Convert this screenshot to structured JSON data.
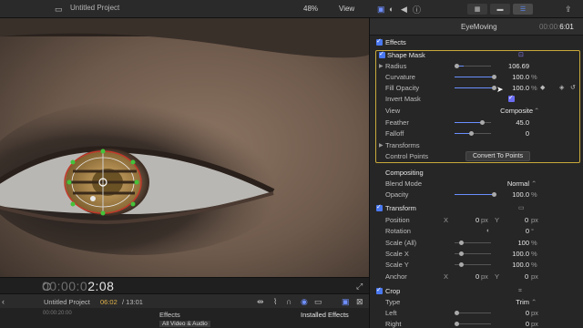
{
  "topbar": {
    "viewer_title": "Untitled Project",
    "zoom": "48%",
    "view_menu": "View"
  },
  "viewer": {
    "timecode_dim": "00:00:0",
    "timecode_bright": "2:08"
  },
  "timeline": {
    "project_name": "Untitled Project",
    "current_time": "06:02",
    "total_time": "/ 13:01",
    "ruler_label": "00:00:20:00",
    "effects_tab": "Effects",
    "effects_sub": "All Video & Audio",
    "installed_effects": "Installed Effects"
  },
  "inspector": {
    "clip_name": "EyeMoving",
    "clip_tc_dim": "00:00:",
    "clip_tc_bright": "6:01",
    "effects_header": "Effects",
    "shape_mask": {
      "title": "Shape Mask",
      "radius": {
        "label": "Radius",
        "value": "106.69"
      },
      "curvature": {
        "label": "Curvature",
        "value": "100.0",
        "unit": "%"
      },
      "fill_opacity": {
        "label": "Fill Opacity",
        "value": "100.0",
        "unit": "%"
      },
      "invert_mask": {
        "label": "Invert Mask"
      },
      "view": {
        "label": "View",
        "value": "Composite"
      },
      "feather": {
        "label": "Feather",
        "value": "45.0"
      },
      "falloff": {
        "label": "Falloff",
        "value": "0"
      },
      "transforms": {
        "label": "Transforms"
      },
      "control_points": {
        "label": "Control Points",
        "button": "Convert To Points"
      }
    },
    "compositing": {
      "header": "Compositing",
      "blend_mode": {
        "label": "Blend Mode",
        "value": "Normal"
      },
      "opacity": {
        "label": "Opacity",
        "value": "100.0",
        "unit": "%"
      }
    },
    "transform": {
      "header": "Transform",
      "position": {
        "label": "Position",
        "x_label": "X",
        "x": "0",
        "y_label": "Y",
        "y": "0",
        "unit": "px"
      },
      "rotation": {
        "label": "Rotation",
        "value": "0",
        "unit": "°"
      },
      "scale_all": {
        "label": "Scale (All)",
        "value": "100",
        "unit": "%"
      },
      "scale_x": {
        "label": "Scale X",
        "value": "100.0",
        "unit": "%"
      },
      "scale_y": {
        "label": "Scale Y",
        "value": "100.0",
        "unit": "%"
      },
      "anchor": {
        "label": "Anchor",
        "x_label": "X",
        "x": "0",
        "y_label": "Y",
        "y": "0",
        "unit": "px"
      }
    },
    "crop": {
      "header": "Crop",
      "type": {
        "label": "Type",
        "value": "Trim"
      },
      "left": {
        "label": "Left",
        "value": "0",
        "unit": "px"
      },
      "right": {
        "label": "Right",
        "value": "0",
        "unit": "px"
      }
    }
  },
  "colors": {
    "accent": "#4a78f0",
    "mask_highlight": "#c9a93a",
    "timecode_orange": "#e0b24a"
  }
}
